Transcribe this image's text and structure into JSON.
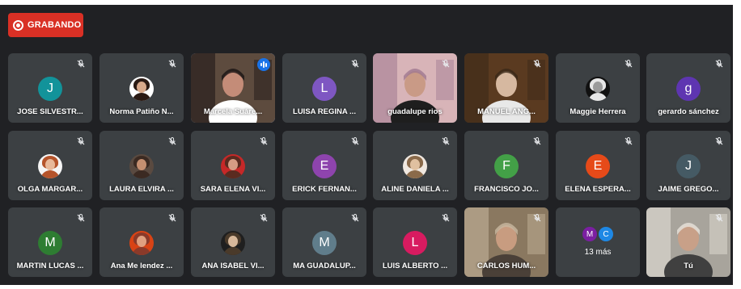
{
  "recording": {
    "label": "GRABANDO",
    "color": "#d93025"
  },
  "participants": [
    {
      "name": "JOSE SILVESTR...",
      "type": "letter",
      "letter": "J",
      "color": "#12939a",
      "muted": true
    },
    {
      "name": "Norma Patiño N...",
      "type": "photo",
      "tones": [
        "#2a1a14",
        "#d7a98b",
        "#ffffff"
      ],
      "muted": true
    },
    {
      "name": "Marcela Suáre...",
      "type": "video",
      "speaking": true,
      "muted": false
    },
    {
      "name": "LUISA REGINA ...",
      "type": "letter",
      "letter": "L",
      "color": "#7e57c2",
      "muted": true
    },
    {
      "name": "guadalupe rios",
      "type": "video",
      "muted": true
    },
    {
      "name": "MANUEL ANG...",
      "type": "video",
      "muted": true
    },
    {
      "name": "Maggie Herrera",
      "type": "photo",
      "tones": [
        "#e6e6e6",
        "#9a9a9a",
        "#111111"
      ],
      "muted": true
    },
    {
      "name": "gerardo sánchez",
      "type": "letter",
      "letter": "g",
      "color": "#5e35b1",
      "muted": true
    },
    {
      "name": "OLGA MARGAR...",
      "type": "photo",
      "tones": [
        "#b5542b",
        "#e8b99a",
        "#f5f5f5"
      ],
      "muted": true
    },
    {
      "name": "LAURA ELVIRA ...",
      "type": "photo",
      "tones": [
        "#3b2a22",
        "#c58f70",
        "#5a4a40"
      ],
      "muted": true
    },
    {
      "name": "SARA ELENA VI...",
      "type": "photo",
      "tones": [
        "#5a2b20",
        "#d69c84",
        "#c62828"
      ],
      "muted": true
    },
    {
      "name": "ERICK FERNAN...",
      "type": "letter",
      "letter": "E",
      "color": "#8e44ad",
      "muted": true
    },
    {
      "name": "ALINE DANIELA ...",
      "type": "photo",
      "tones": [
        "#8a6a4a",
        "#e0c0a0",
        "#f0e8e0"
      ],
      "muted": true
    },
    {
      "name": "FRANCISCO JO...",
      "type": "letter",
      "letter": "F",
      "color": "#43a047",
      "muted": true
    },
    {
      "name": "ELENA ESPERA...",
      "type": "letter",
      "letter": "E",
      "color": "#e64a19",
      "muted": true
    },
    {
      "name": "JAIME GREGO...",
      "type": "letter",
      "letter": "J",
      "color": "#455a64",
      "muted": true
    },
    {
      "name": "MARTIN LUCAS ...",
      "type": "letter",
      "letter": "M",
      "color": "#2e7d32",
      "muted": true
    },
    {
      "name": "Ana Me lendez ...",
      "type": "photo",
      "tones": [
        "#8a3a2a",
        "#e0a080",
        "#d84315"
      ],
      "muted": true
    },
    {
      "name": "ANA ISABEL VI...",
      "type": "photo",
      "tones": [
        "#4a3a2a",
        "#d8b89a",
        "#1f1f1f"
      ],
      "muted": true
    },
    {
      "name": "MA GUADALUP...",
      "type": "letter",
      "letter": "M",
      "color": "#607d8b",
      "muted": true
    },
    {
      "name": "LUIS ALBERTO ...",
      "type": "letter",
      "letter": "L",
      "color": "#d81b60",
      "muted": true
    },
    {
      "name": "CARLOS HUM...",
      "type": "video",
      "muted": true
    },
    {
      "name": "",
      "type": "more",
      "muted": false
    },
    {
      "name": "Tú",
      "type": "video",
      "muted": true
    }
  ],
  "more_tile": {
    "label": "13 más",
    "avatars": [
      {
        "letter": "M",
        "color": "#7b1fa2"
      },
      {
        "letter": "C",
        "color": "#1e88e5"
      }
    ]
  },
  "video_scenes": {
    "2": {
      "bg": "#5d4b3e",
      "accent": "#1a1414",
      "face": "#c48c78",
      "shirt": "#ffffff"
    },
    "4": {
      "bg": "#d8b4b8",
      "accent": "#a07890",
      "face": "#c99a86",
      "shirt": "#1e1e1e"
    },
    "5": {
      "bg": "#5a3a20",
      "accent": "#3a2818",
      "face": "#d6b8a0",
      "shirt": "#e8e8e8"
    },
    "21": {
      "bg": "#8a7860",
      "accent": "#c8b8a0",
      "face": "#c89c80",
      "shirt": "#4a4038"
    },
    "23": {
      "bg": "#a8a49c",
      "accent": "#e8e4dc",
      "face": "#c8a088",
      "shirt": "#404040"
    }
  }
}
